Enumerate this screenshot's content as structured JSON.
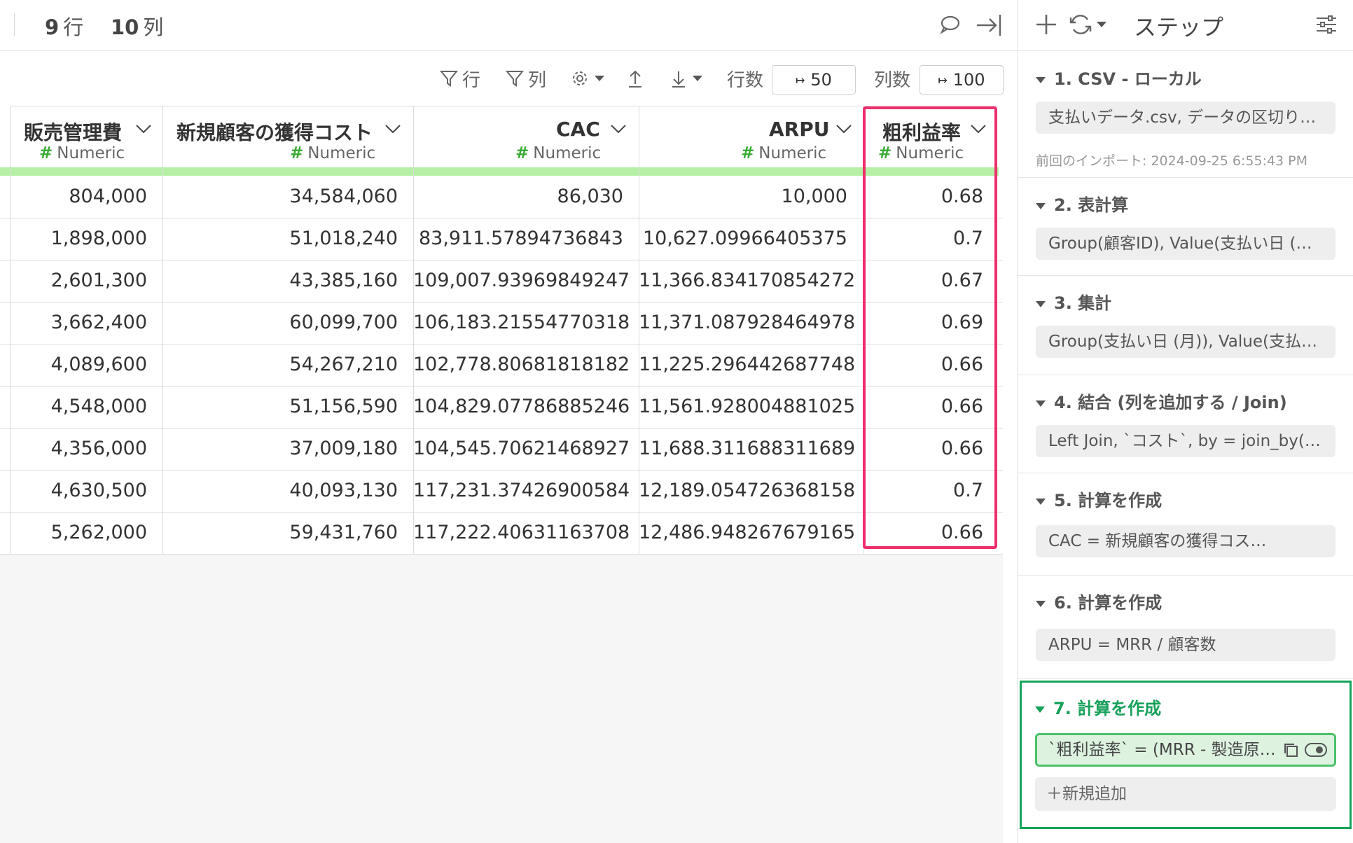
{
  "topbar": {
    "rows_num": "9",
    "rows_unit": "行",
    "cols_num": "10",
    "cols_unit": "列"
  },
  "toolbar": {
    "filter_rows": "行",
    "filter_cols": "列",
    "rows_label": "行数",
    "rows_value": "50",
    "cols_label": "列数",
    "cols_value": "100"
  },
  "table": {
    "columns": [
      {
        "name": "販売管理費",
        "type": "Numeric"
      },
      {
        "name": "新規顧客の獲得コスト",
        "type": "Numeric"
      },
      {
        "name": "CAC",
        "type": "Numeric"
      },
      {
        "name": "ARPU",
        "type": "Numeric"
      },
      {
        "name": "粗利益率",
        "type": "Numeric"
      }
    ],
    "rows": [
      [
        "804,000",
        "34,584,060",
        "86,030",
        "10,000",
        "0.68"
      ],
      [
        "1,898,000",
        "51,018,240",
        "83,911.57894736843",
        "10,627.09966405375",
        "0.7"
      ],
      [
        "2,601,300",
        "43,385,160",
        "109,007.93969849247",
        "11,366.834170854272",
        "0.67"
      ],
      [
        "3,662,400",
        "60,099,700",
        "106,183.21554770318",
        "11,371.087928464978",
        "0.69"
      ],
      [
        "4,089,600",
        "54,267,210",
        "102,778.80681818182",
        "11,225.296442687748",
        "0.66"
      ],
      [
        "4,548,000",
        "51,156,590",
        "104,829.07786885246",
        "11,561.928004881025",
        "0.66"
      ],
      [
        "4,356,000",
        "37,009,180",
        "104,545.70621468927",
        "11,688.311688311689",
        "0.66"
      ],
      [
        "4,630,500",
        "40,093,130",
        "117,231.37426900584",
        "12,189.054726368158",
        "0.7"
      ],
      [
        "5,262,000",
        "59,431,760",
        "117,222.40631163708",
        "12,486.948267679165",
        "0.66"
      ]
    ]
  },
  "panel": {
    "title": "ステップ",
    "steps": [
      {
        "label": "1. CSV - ローカル",
        "box": "支払いデータ.csv, データの区切り…",
        "note": "前回のインポート: 2024-09-25 6:55:43 PM"
      },
      {
        "label": "2. 表計算",
        "box": "Group(顧客ID), Value(支払い日 (Den…"
      },
      {
        "label": "3. 集計",
        "box": "Group(支払い日 (月)), Value(支払い…"
      },
      {
        "label": "4. 結合 (列を追加する / Join)",
        "box": "Left Join, `コスト`, by = join_by(`支…"
      },
      {
        "label": "5. 計算を作成",
        "box": "CAC = 新規顧客の獲得コス…"
      },
      {
        "label": "6. 計算を作成",
        "box": "ARPU = MRR / 顧客数"
      },
      {
        "label": "7. 計算を作成",
        "box": "`粗利益率` = (MRR - 製造原…"
      }
    ],
    "add_new": "＋新規追加"
  },
  "colors": {
    "highlight": "#ee2f6c",
    "active_step": "#16a55a",
    "quality_bar": "#b6f0a7",
    "numeric_hash": "#3aaa35"
  }
}
